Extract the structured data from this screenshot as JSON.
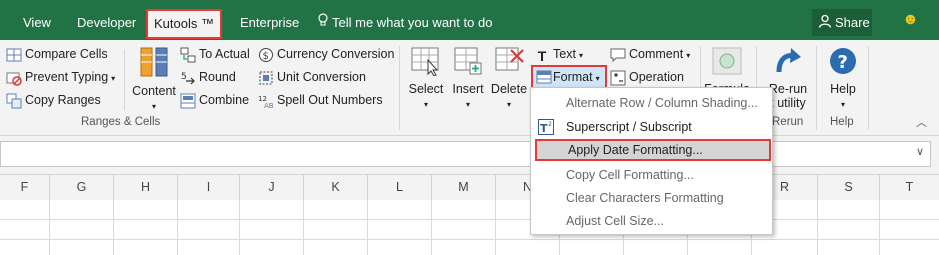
{
  "tabs": {
    "view": "View",
    "developer": "Developer",
    "kutools": "Kutools ™",
    "enterprise": "Enterprise",
    "tell_me": "Tell me what you want to do",
    "share": "Share"
  },
  "ribbon": {
    "compare_cells": "Compare Cells",
    "prevent_typing": "Prevent Typing",
    "copy_ranges": "Copy Ranges",
    "content": "Content",
    "to_actual": "To Actual",
    "round": "Round",
    "combine": "Combine",
    "currency_conversion": "Currency Conversion",
    "unit_conversion": "Unit Conversion",
    "spell_out_numbers": "Spell Out Numbers",
    "group_ranges_cells": "Ranges & Cells",
    "select": "Select",
    "insert": "Insert",
    "delete": "Delete",
    "text": "Text",
    "format": "Format",
    "comment": "Comment",
    "operation": "Operation",
    "formula": "Formula",
    "rerun_1": "Re-run",
    "rerun_2": "t utility",
    "rerun_group": "Rerun",
    "help": "Help",
    "help_group": "Help"
  },
  "menu": {
    "items": [
      "Alternate Row / Column Shading...",
      "Superscript / Subscript",
      "Apply Date Formatting...",
      "Copy Cell Formatting...",
      "Clear Characters Formatting",
      "Adjust Cell Size..."
    ],
    "highlighted_index": 2
  },
  "columns": [
    "F",
    "G",
    "H",
    "I",
    "J",
    "K",
    "L",
    "M",
    "N",
    "O",
    "P",
    "Q",
    "R",
    "S",
    "T"
  ],
  "colors": {
    "tabbar": "#217346",
    "highlight_border": "#e53935",
    "ribbon_bg": "#f3f3f3"
  }
}
